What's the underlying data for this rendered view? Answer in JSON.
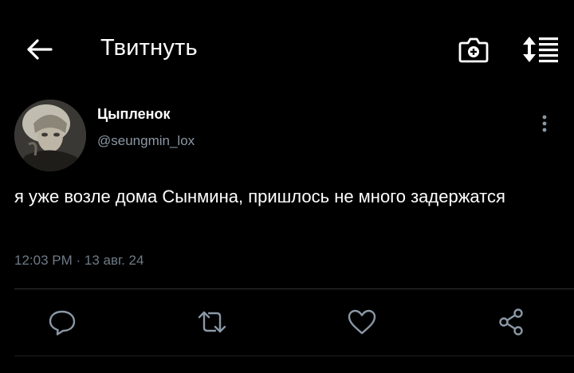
{
  "header": {
    "title": "Твитнуть",
    "icons": {
      "back": "arrow-left-icon",
      "camera": "camera-plus-icon",
      "sort": "sort-list-icon"
    }
  },
  "tweet": {
    "author": {
      "display_name": "Цыпленок",
      "handle": "@seungmin_lox"
    },
    "text": "я уже возле дома Сынмина, пришлось не много задержатся",
    "meta": "12:03 PM · 13 авг. 24"
  },
  "actions": {
    "reply": "reply-icon",
    "retweet": "retweet-icon",
    "like": "heart-icon",
    "share": "share-icon"
  },
  "colors": {
    "background": "#000000",
    "text": "#ffffff",
    "secondary_text": "#8b98a5",
    "icon": "#8b98a5",
    "divider": "#2f3336"
  }
}
